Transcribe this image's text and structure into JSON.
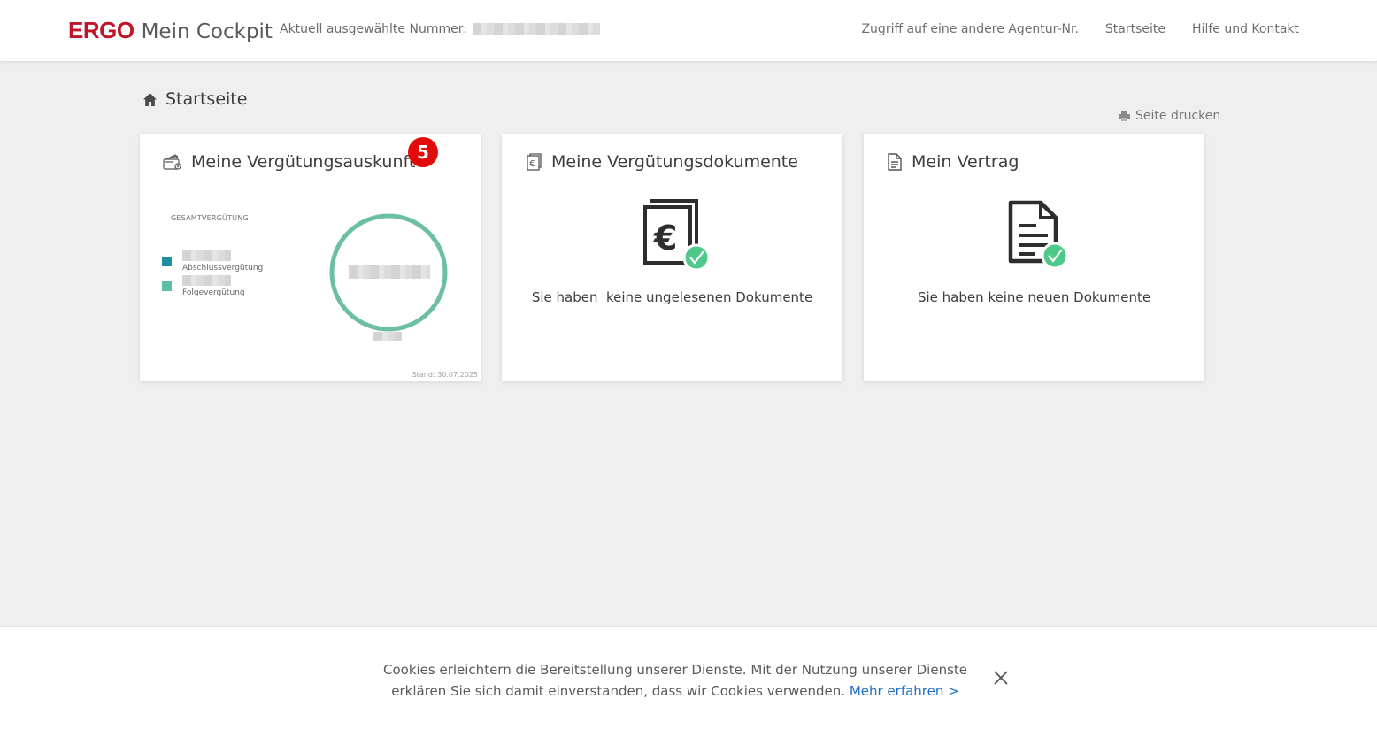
{
  "header": {
    "brand": "ERGO",
    "app_name": "Mein Cockpit",
    "current_number_label": "Aktuell ausgewählte Nummer:",
    "nav": [
      {
        "label": "Zugriff auf eine andere Agentur-Nr."
      },
      {
        "label": "Startseite"
      },
      {
        "label": "Hilfe und Kontakt"
      }
    ]
  },
  "breadcrumb": {
    "title": "Startseite",
    "icon": "home-icon"
  },
  "print": {
    "label": "Seite drucken",
    "icon": "printer-icon"
  },
  "cards": [
    {
      "title": "Meine Vergütungsauskunft",
      "icon": "wallet-icon",
      "badge": "5",
      "total_label": "GESAMTVERGÜTUNG",
      "legend": [
        {
          "label": "Abschlussvergütung",
          "color": "#1d8fa3"
        },
        {
          "label": "Folgevergütung",
          "color": "#5cbfa5"
        }
      ],
      "donut_color": "#6cbfa5",
      "stand": "Stand: 30.07.2025"
    },
    {
      "title": "Meine Vergütungsdokumente",
      "icon": "euro-document-icon",
      "message": "Sie haben  keine ungelesenen Dokumente"
    },
    {
      "title": "Mein Vertrag",
      "icon": "document-icon",
      "message": "Sie haben keine neuen Dokumente"
    }
  ],
  "cookie": {
    "text": "Cookies erleichtern die Bereitstellung unserer Dienste. Mit der Nutzung unserer Dienste erklären Sie sich damit einverstanden, dass wir Cookies verwenden.",
    "link": "Mehr erfahren >"
  },
  "colors": {
    "brand": "#bf1528",
    "badge": "#e30a0a",
    "check": "#4fc98a",
    "link": "#1f6fc3"
  }
}
